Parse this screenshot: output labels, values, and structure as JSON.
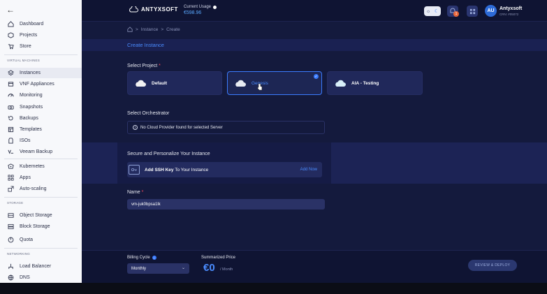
{
  "sidebar": {
    "items_top": [
      {
        "label": "Dashboard",
        "icon": "home-icon"
      },
      {
        "label": "Projects",
        "icon": "cube-icon"
      },
      {
        "label": "Store",
        "icon": "cart-icon"
      }
    ],
    "section_vm": "VIRTUAL MACHINES",
    "items_vm": [
      {
        "label": "Instances",
        "icon": "layers-icon"
      },
      {
        "label": "VNF Appliances",
        "icon": "package-icon"
      },
      {
        "label": "Monitoring",
        "icon": "gauge-icon"
      },
      {
        "label": "Snapshots",
        "icon": "camera-icon"
      },
      {
        "label": "Backups",
        "icon": "backup-icon"
      },
      {
        "label": "Templates",
        "icon": "template-icon"
      },
      {
        "label": "ISOs",
        "icon": "disc-icon"
      },
      {
        "label": "Veeam Backup",
        "icon": "veeam-icon"
      },
      {
        "label": "Kubernetes",
        "icon": "kubernetes-icon"
      },
      {
        "label": "Apps",
        "icon": "apps-icon"
      },
      {
        "label": "Auto-scaling",
        "icon": "scaling-icon"
      }
    ],
    "section_storage": "STORAGE",
    "items_storage": [
      {
        "label": "Object Storage",
        "icon": "object-storage-icon"
      },
      {
        "label": "Block Storage",
        "icon": "block-storage-icon"
      },
      {
        "label": "Quota",
        "icon": "quota-icon"
      }
    ],
    "section_networking": "NETWORKING",
    "items_networking": [
      {
        "label": "Load Balancer",
        "icon": "load-balancer-icon"
      },
      {
        "label": "DNS",
        "icon": "globe-icon"
      }
    ]
  },
  "topbar": {
    "logo": "ANTYXSOFT",
    "usage_label": "Current Usage",
    "usage_value": "€598.96",
    "notification_count": "1",
    "avatar_initials": "AU",
    "user_name": "Antyxsoft",
    "user_id": "CRN: #05072"
  },
  "breadcrumb": {
    "instance": "Instance",
    "create": "Create"
  },
  "page_title": "Create Instance",
  "project": {
    "label": "Select Project",
    "required": "*",
    "options": [
      {
        "name": "Default",
        "selected": false
      },
      {
        "name": "Genesis",
        "selected": true
      },
      {
        "name": "AIA - Testing",
        "selected": false
      }
    ]
  },
  "orchestrator": {
    "label": "Select Orchestrator",
    "message": "No Cloud Provider found for selected Server"
  },
  "secure": {
    "label": "Secure and Personalize Your Instance",
    "ssh_bold": "Add SSH Key",
    "ssh_rest": " To Your Instance",
    "add_now": "Add Now"
  },
  "name_field": {
    "label": "Name",
    "required": "*",
    "value": "vm-juk0bpsa1lk"
  },
  "billing": {
    "label": "Billing Cycle",
    "value": "Monthly"
  },
  "price": {
    "label": "Summarized Price",
    "value": "€0",
    "unit": "/ Month"
  },
  "deploy_label": "REVIEW & DEPLOY",
  "colors": {
    "accent": "#4a8cff",
    "background": "#141a3d",
    "sidebar": "#f7f8fb"
  }
}
